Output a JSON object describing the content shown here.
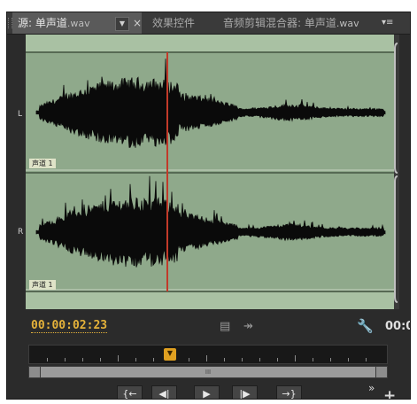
{
  "tabs": [
    {
      "label": "源: 单声道",
      "ext": ".wav",
      "active": true
    },
    {
      "label": "效果控件",
      "ext": "",
      "active": false
    },
    {
      "label": "音频剪辑混合器: 单声道",
      "ext": ".wav",
      "active": false
    }
  ],
  "tab_dropdown_glyph": "▼",
  "tab_close_glyph": "×",
  "panel_menu_glyph": "▾≡",
  "channels": {
    "left_label": "L",
    "right_label": "R",
    "track_labels": [
      "声道 1",
      "声道 1"
    ]
  },
  "timecode": "00:00:02:23",
  "timecode_right": "00:0",
  "playhead_fraction": 0.385,
  "icons": [
    "film-icon",
    "insert-icon",
    "wrench-icon",
    "extend-icon",
    "add-icon"
  ],
  "transport": {
    "buttons": [
      {
        "name": "mark-in-button",
        "glyph": "{←"
      },
      {
        "name": "step-back-button",
        "glyph": "◀|"
      },
      {
        "name": "play-button",
        "glyph": "▶"
      },
      {
        "name": "step-forward-button",
        "glyph": "|▶"
      },
      {
        "name": "mark-out-button",
        "glyph": "→}"
      }
    ],
    "more_glyph": "»",
    "add_glyph": "+"
  },
  "scroll_grip": "III",
  "colors": {
    "waveform_bg": "#8fa98b",
    "playhead": "#c23a2a",
    "timecode": "#e5b23a"
  }
}
